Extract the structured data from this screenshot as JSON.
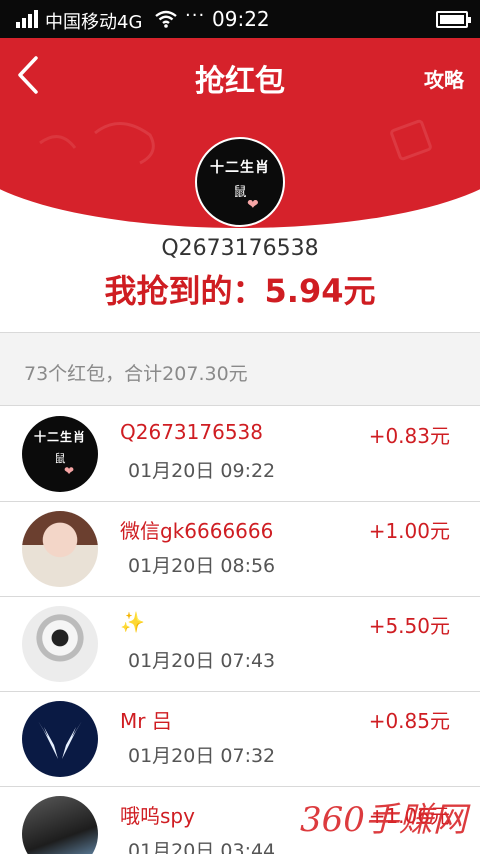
{
  "status_bar": {
    "carrier": "中国移动4G",
    "dots": "···",
    "time": "09:22"
  },
  "header": {
    "title": "抢红包",
    "guide_label": "攻略"
  },
  "profile": {
    "avatar_line1": "十二生肖",
    "avatar_line2": "鼠",
    "username": "Q2673176538",
    "got_text": "我抢到的：5.94元"
  },
  "summary": {
    "text": "73个红包，合计207.30元"
  },
  "records": [
    {
      "name": "Q2673176538",
      "time": "01月20日 09:22",
      "amount": "+0.83元",
      "avatar": "zodiac"
    },
    {
      "name": "微信gk6666666",
      "time": "01月20日 08:56",
      "amount": "+1.00元",
      "avatar": "girl"
    },
    {
      "name": "✨",
      "time": "01月20日 07:43",
      "amount": "+5.50元",
      "avatar": "bw"
    },
    {
      "name": "Mr 吕",
      "time": "01月20日 07:32",
      "amount": "+0.85元",
      "avatar": "wings"
    },
    {
      "name": "哦呜spy",
      "time": "01月20日 03:44",
      "amount": "+1.06元",
      "avatar": "dark"
    }
  ],
  "watermark": "360手赚网",
  "colors": {
    "header_red": "#d0050d",
    "arc_red": "#d6222b",
    "accent_red": "#cf1d22"
  }
}
